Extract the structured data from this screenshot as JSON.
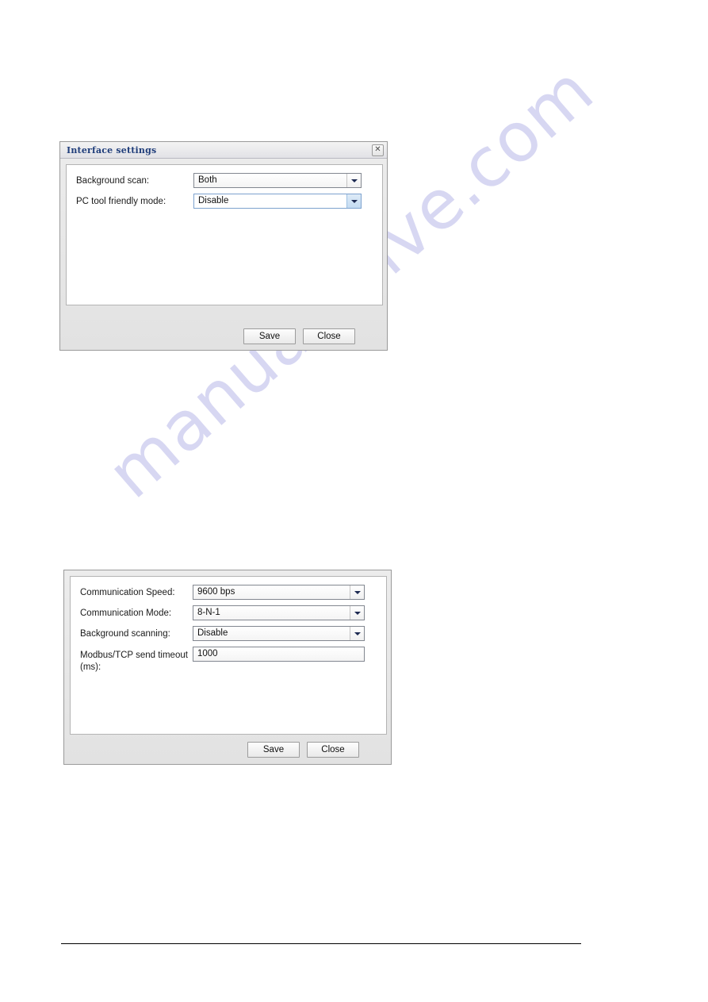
{
  "watermark": {
    "text": "manualshive.com"
  },
  "dialog_interface_settings": {
    "title": "Interface settings",
    "close_icon": "close-icon",
    "close_glyph": "✕",
    "fields": [
      {
        "label": "Background scan:",
        "value": "Both",
        "type": "combobox",
        "focused": false
      },
      {
        "label": "PC tool friendly mode:",
        "value": "Disable",
        "type": "combobox",
        "focused": true
      }
    ],
    "buttons": {
      "save": "Save",
      "close": "Close"
    }
  },
  "dialog_serial_settings": {
    "fields": [
      {
        "label": "Communication Speed:",
        "value": "9600 bps",
        "type": "combobox"
      },
      {
        "label": "Communication Mode:",
        "value": "8-N-1",
        "type": "combobox"
      },
      {
        "label": "Background scanning:",
        "value": "Disable",
        "type": "combobox"
      },
      {
        "label": "Modbus/TCP send timeout (ms):",
        "value": "1000",
        "type": "textinput"
      }
    ],
    "buttons": {
      "save": "Save",
      "close": "Close"
    }
  },
  "colors": {
    "title_text": "#1f3d7a",
    "dialog_face": "#e6e6e6",
    "panel": "#ffffff",
    "watermark": "#c9c9ee",
    "focus_border": "#7da2ce"
  }
}
